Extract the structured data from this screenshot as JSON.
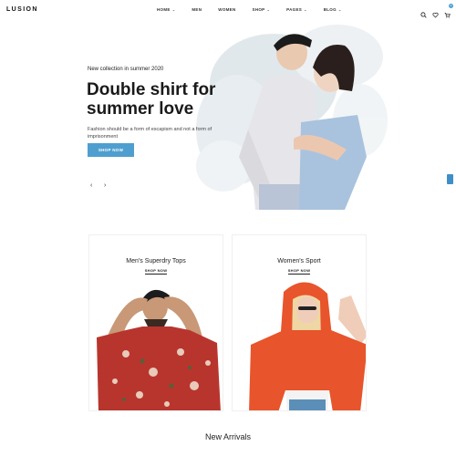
{
  "brand": {
    "logo": "LUSION"
  },
  "nav": [
    {
      "label": "HOME",
      "dropdown": true
    },
    {
      "label": "MEN",
      "dropdown": false
    },
    {
      "label": "WOMEN",
      "dropdown": false
    },
    {
      "label": "SHOP",
      "dropdown": true
    },
    {
      "label": "PAGES",
      "dropdown": true
    },
    {
      "label": "BLOG",
      "dropdown": true
    }
  ],
  "header_icons": {
    "search": "search-icon",
    "wishlist": "heart-icon",
    "cart": "cart-icon",
    "cart_count": "0"
  },
  "hero": {
    "kicker": "New collection in summer 2020",
    "title": "Double shirt for summer love",
    "description": "Fashion should be a form of escapism and not a form of imprisonment",
    "button": "SHOP NOW",
    "prev": "‹",
    "next": "›"
  },
  "categories": [
    {
      "title": "Men's Superdry Tops",
      "link": "SHOP NOW"
    },
    {
      "title": "Women's Sport",
      "link": "SHOP NOW"
    }
  ],
  "section": {
    "title": "New Arrivals"
  },
  "colors": {
    "accent": "#4e9fcf",
    "side_tab": "#3f8fc6",
    "man_shirt": "#b8352e",
    "woman_hoodie": "#e8542b"
  }
}
